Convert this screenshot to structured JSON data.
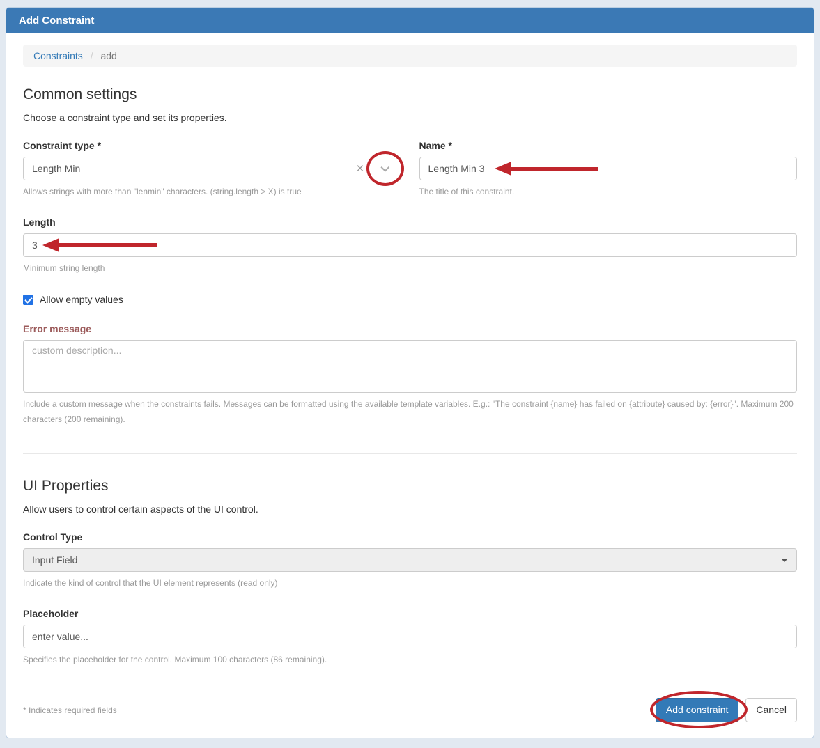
{
  "panel": {
    "title": "Add Constraint"
  },
  "breadcrumb": {
    "link": "Constraints",
    "separator": "/",
    "current": "add"
  },
  "icons": {
    "clear": "×"
  },
  "common": {
    "heading": "Common settings",
    "subheading": "Choose a constraint type and set its properties.",
    "constraint_type": {
      "label": "Constraint type *",
      "value": "Length Min",
      "help": "Allows strings with more than \"lenmin\" characters. (string.length > X) is true"
    },
    "name": {
      "label": "Name *",
      "value": "Length Min 3",
      "help": "The title of this constraint."
    },
    "length": {
      "label": "Length",
      "value": "3",
      "help": "Minimum string length"
    },
    "allow_empty": {
      "label": "Allow empty values",
      "checked": true
    },
    "error_message": {
      "label": "Error message",
      "placeholder": "custom description...",
      "help": "Include a custom message when the constraints fails. Messages can be formatted using the available template variables. E.g.: \"The constraint {name} has failed on {attribute} caused by: {error}\". Maximum 200 characters (200 remaining)."
    }
  },
  "ui_properties": {
    "heading": "UI Properties",
    "subheading": "Allow users to control certain aspects of the UI control.",
    "control_type": {
      "label": "Control Type",
      "value": "Input Field",
      "help": "Indicate the kind of control that the UI element represents (read only)"
    },
    "placeholder": {
      "label": "Placeholder",
      "value": "enter value...",
      "help": "Specifies the placeholder for the control. Maximum 100 characters (86 remaining)."
    }
  },
  "footer": {
    "required_note": "* Indicates required fields",
    "submit_label": "Add constraint",
    "cancel_label": "Cancel"
  },
  "annotations": {
    "circled_elements": [
      "constraint-type-chevron",
      "add-constraint-button"
    ],
    "arrow_pointed_fields": [
      "name-input",
      "length-input"
    ],
    "color": "#c0262c"
  },
  "colors": {
    "header_bg": "#3b79b5",
    "link": "#337ab7",
    "primary_button": "#337ab7",
    "error_label": "#9c5b5b",
    "checkbox_blue": "#2172e5",
    "annotation_red": "#c0262c"
  }
}
